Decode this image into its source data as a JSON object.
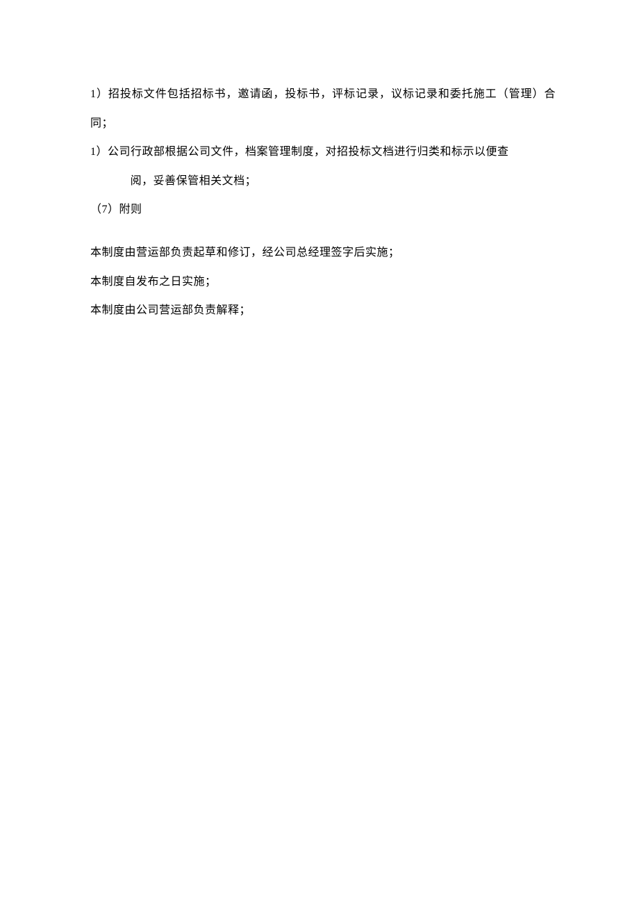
{
  "document": {
    "paragraphs": [
      {
        "text": "1）招投标文件包括招标书，邀请函，投标书，评标记录，议标记录和委托施工（管理）合同；",
        "class": "para"
      },
      {
        "text": "1）公司行政部根据公司文件，档案管理制度，对招投标文档进行归类和标示以便查",
        "class": "para indent-hang"
      },
      {
        "text": "阅，妥善保管相关文档；",
        "class": "para indent-sub"
      },
      {
        "text": "（7）附则",
        "class": "para"
      },
      {
        "text": "本制度由营运部负责起草和修订，经公司总经理签字后实施；",
        "class": "para section-gap"
      },
      {
        "text": "本制度自发布之日实施；",
        "class": "para"
      },
      {
        "text": "本制度由公司营运部负责解释；",
        "class": "para"
      }
    ]
  }
}
